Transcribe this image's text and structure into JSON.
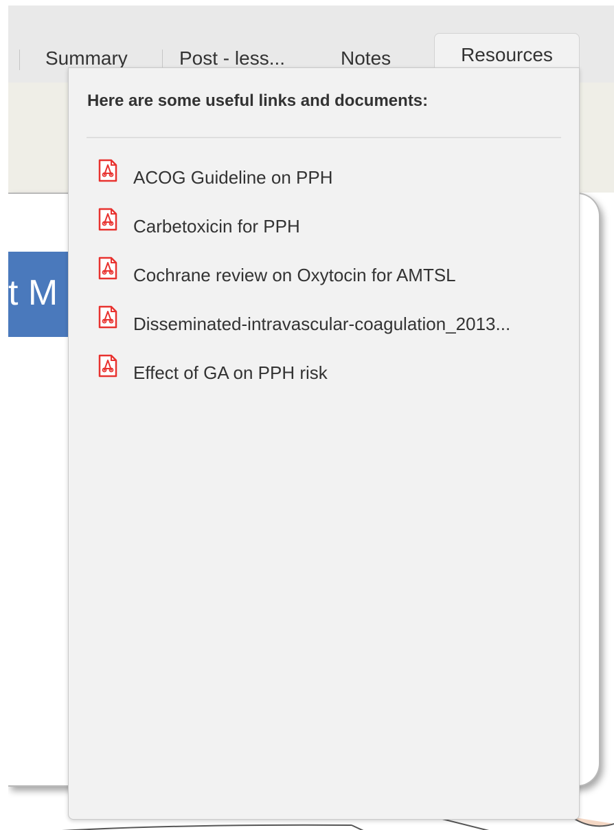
{
  "tabs": {
    "summary": "Summary",
    "post_lesson": "Post - less...",
    "notes": "Notes",
    "resources": "Resources",
    "active": "Resources"
  },
  "slide": {
    "title_fragment": "t M"
  },
  "resources_panel": {
    "heading": "Here are some useful links and documents:",
    "items": [
      {
        "label": "ACOG Guideline on PPH",
        "icon": "pdf-icon"
      },
      {
        "label": "Carbetoxicin for PPH",
        "icon": "pdf-icon"
      },
      {
        "label": "Cochrane review on Oxytocin for AMTSL",
        "icon": "pdf-icon"
      },
      {
        "label": "Disseminated-intravascular-coagulation_2013...",
        "icon": "pdf-icon"
      },
      {
        "label": "Effect of GA on PPH risk",
        "icon": "pdf-icon"
      }
    ]
  },
  "colors": {
    "pdf_icon": "#e8322f",
    "slide_title_bg": "#4a79bc",
    "panel_bg": "#f2f2f2",
    "tabbar_bg": "#e9e9e9"
  }
}
